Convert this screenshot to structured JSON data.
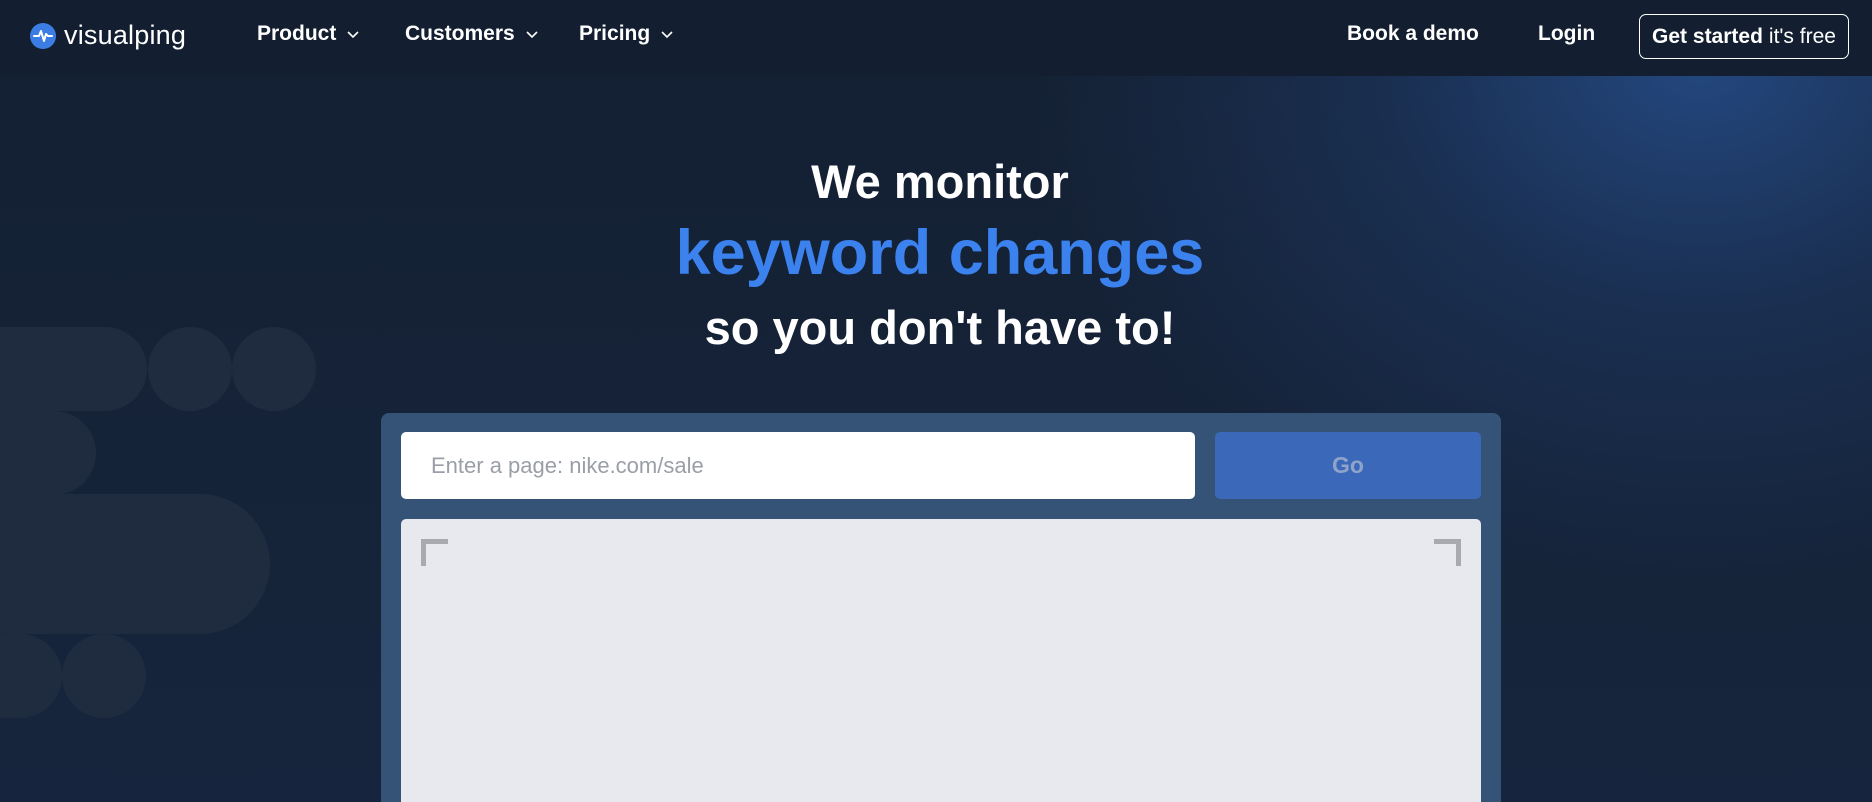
{
  "brand": {
    "name": "visualping",
    "accent": "#3b82ef"
  },
  "nav": {
    "items": [
      {
        "label": "Product",
        "icon": "chevron-down-icon"
      },
      {
        "label": "Customers",
        "icon": "chevron-down-icon"
      },
      {
        "label": "Pricing",
        "icon": "chevron-down-icon"
      }
    ],
    "book_demo": "Book a demo",
    "login": "Login",
    "cta_strong": "Get started",
    "cta_light": "it's free"
  },
  "hero": {
    "line1": "We monitor",
    "line2": "keyword changes",
    "line3": "so you don't have to!"
  },
  "monitor": {
    "placeholder": "Enter a page: nike.com/sale",
    "value": "",
    "go_label": "Go"
  }
}
